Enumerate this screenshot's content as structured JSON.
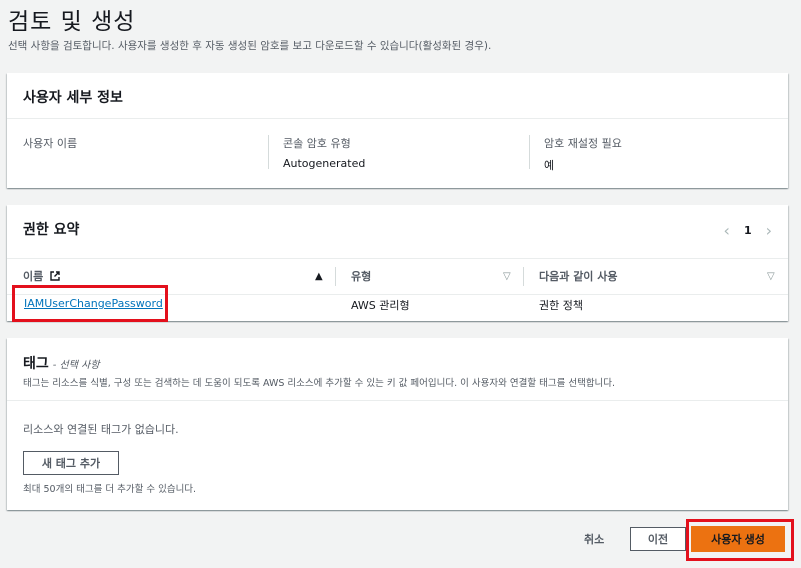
{
  "page": {
    "title": "검토 및 생성",
    "description": "선택 사항을 검토합니다. 사용자를 생성한 후 자동 생성된 암호를 보고 다운로드할 수 있습니다(활성화된 경우)."
  },
  "user_details": {
    "title": "사용자 세부 정보",
    "fields": [
      {
        "label": "사용자 이름",
        "value": ""
      },
      {
        "label": "콘솔 암호 유형",
        "value": "Autogenerated"
      },
      {
        "label": "암호 재설정 필요",
        "value": "예"
      }
    ]
  },
  "permissions": {
    "title": "권한 요약",
    "page": "1",
    "columns": [
      "이름",
      "유형",
      "다음과 같이 사용"
    ],
    "rows": [
      {
        "name": "IAMUserChangePassword",
        "type": "AWS 관리형",
        "used_as": "권한 정책"
      }
    ]
  },
  "tags": {
    "title": "태그",
    "optional": "- 선택 사항",
    "description": "태그는 리소스를 식별, 구성 또는 검색하는 데 도움이 되도록 AWS 리소스에 추가할 수 있는 키 값 페어입니다. 이 사용자와 연결할 태그를 선택합니다.",
    "empty_text": "리소스와 연결된 태그가 없습니다.",
    "add_button": "새 태그 추가",
    "limit_text": "최대 50개의 태그를 더 추가할 수 있습니다."
  },
  "footer": {
    "cancel": "취소",
    "previous": "이전",
    "create": "사용자 생성"
  }
}
